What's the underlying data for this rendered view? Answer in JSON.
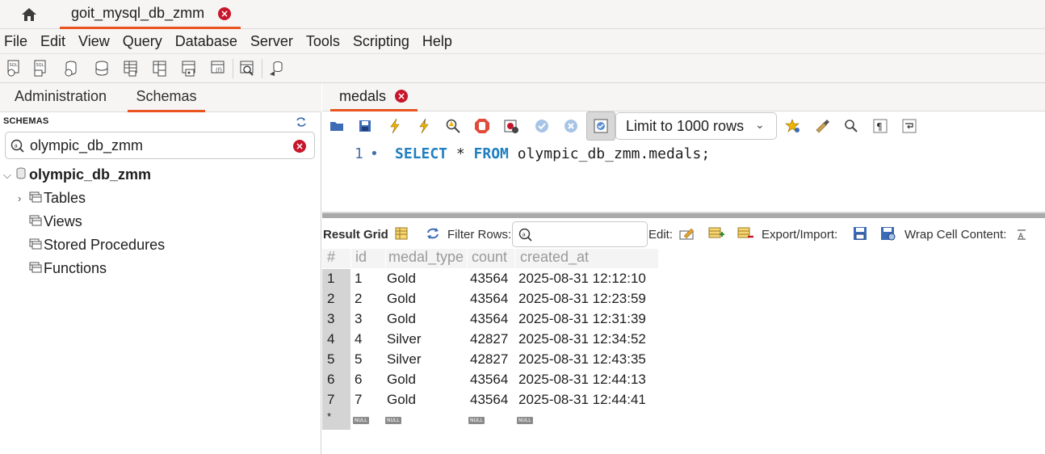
{
  "connection_tab": {
    "label": "goit_mysql_db_zmm"
  },
  "menu": [
    "File",
    "Edit",
    "View",
    "Query",
    "Database",
    "Server",
    "Tools",
    "Scripting",
    "Help"
  ],
  "sidebar": {
    "tabs": [
      "Administration",
      "Schemas"
    ],
    "active_tab": "Schemas",
    "header": "SCHEMAS",
    "search_value": "olympic_db_zmm",
    "schema_name": "olympic_db_zmm",
    "children": [
      "Tables",
      "Views",
      "Stored Procedures",
      "Functions"
    ]
  },
  "editor": {
    "tab_label": "medals",
    "limit_select": "Limit to 1000 rows",
    "line_number": "1",
    "line_marker": "•",
    "sql_keyword_select": "SELECT",
    "sql_star": " * ",
    "sql_keyword_from": "FROM",
    "sql_rest": " olympic_db_zmm.medals;"
  },
  "result_toolbar": {
    "result_grid": "Result Grid",
    "filter_rows": "Filter Rows:",
    "edit": "Edit:",
    "export_import": "Export/Import:",
    "wrap_cell": "Wrap Cell Content:"
  },
  "grid": {
    "columns": [
      "#",
      "id",
      "medal_type",
      "count",
      "created_at"
    ],
    "rows": [
      [
        "1",
        "1",
        "Gold",
        "43564",
        "2025-08-31 12:12:10"
      ],
      [
        "2",
        "2",
        "Gold",
        "43564",
        "2025-08-31 12:23:59"
      ],
      [
        "3",
        "3",
        "Gold",
        "43564",
        "2025-08-31 12:31:39"
      ],
      [
        "4",
        "4",
        "Silver",
        "42827",
        "2025-08-31 12:34:52"
      ],
      [
        "5",
        "5",
        "Silver",
        "42827",
        "2025-08-31 12:43:35"
      ],
      [
        "6",
        "6",
        "Gold",
        "43564",
        "2025-08-31 12:44:13"
      ],
      [
        "7",
        "7",
        "Gold",
        "43564",
        "2025-08-31 12:44:41"
      ]
    ],
    "new_row_marker": "*",
    "null_label": "NULL"
  },
  "colors": {
    "accent": "#e95420",
    "close": "#c7162b",
    "keyword": "#1f7fbf"
  }
}
